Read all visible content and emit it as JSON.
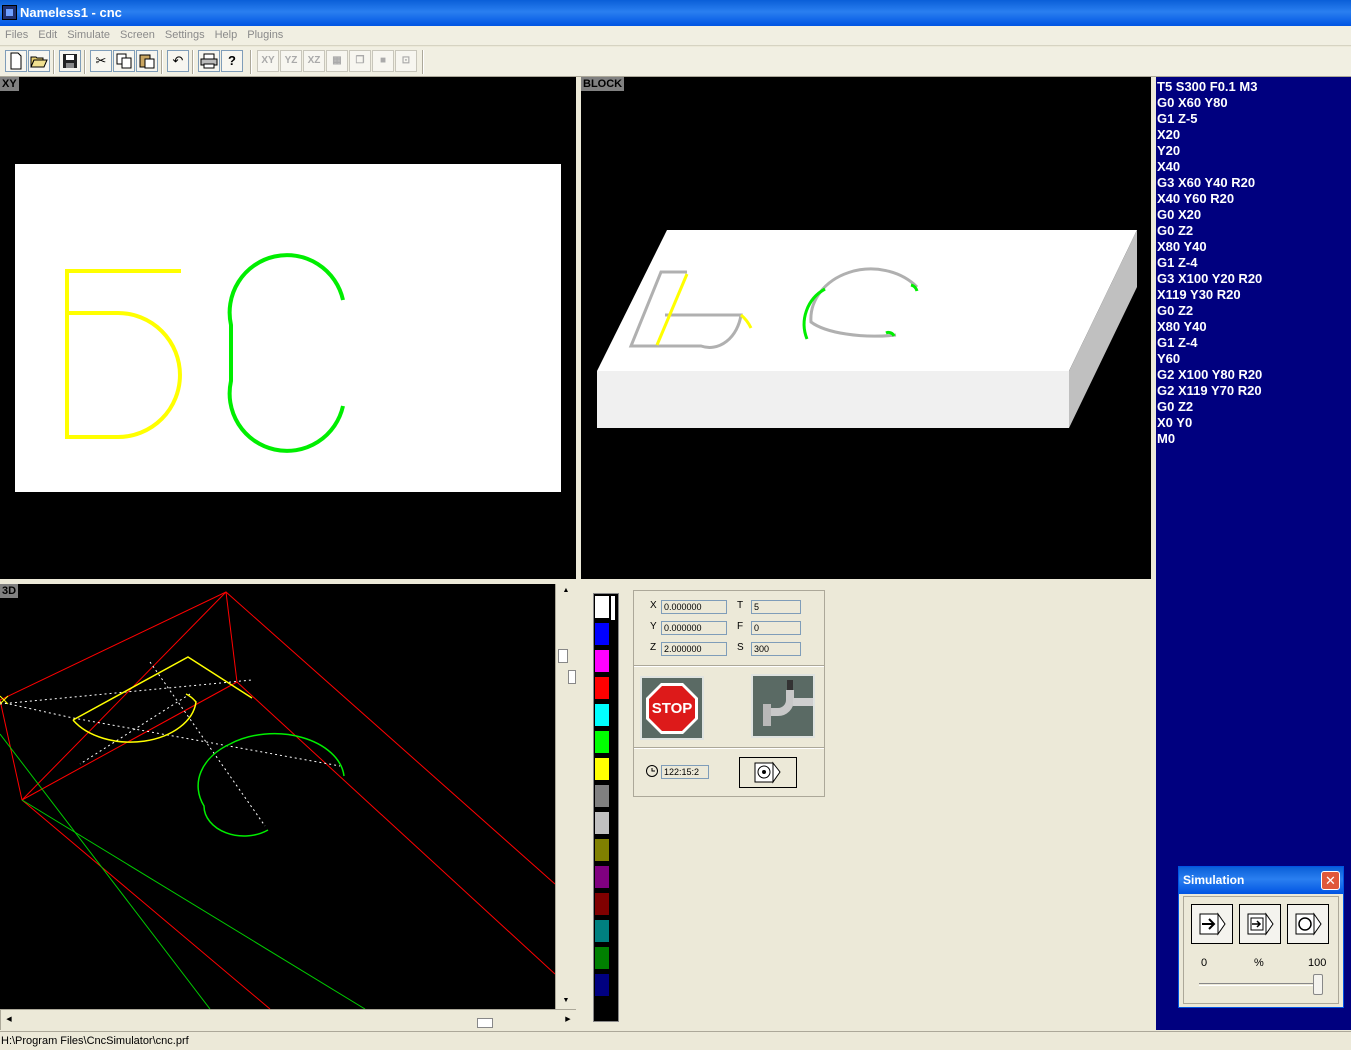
{
  "window": {
    "title": "Nameless1 - cnc"
  },
  "menu": [
    "Files",
    "Edit",
    "Simulate",
    "Screen",
    "Settings",
    "Help",
    "Plugins"
  ],
  "toolbar": {
    "icons": [
      "new-file",
      "open-file",
      "save",
      "cut",
      "copy",
      "paste",
      "undo",
      "print",
      "help"
    ],
    "view_buttons": [
      "XY",
      "YZ",
      "XZ"
    ]
  },
  "views": {
    "xy_label": "XY",
    "block_label": "BLOCK",
    "threed_label": "3D"
  },
  "engraving": {
    "letters": "БС",
    "colors": {
      "b": "#ffff00",
      "s": "#00ee00"
    }
  },
  "gcode": [
    "T5 S300 F0.1 M3",
    "G0 X60 Y80",
    "G1 Z-5",
    "X20",
    "Y20",
    "X40",
    "G3 X60 Y40 R20",
    "X40 Y60 R20",
    "G0 X20",
    "G0 Z2",
    "X80 Y40",
    "G1 Z-4",
    "G3 X100 Y20 R20",
    "X119 Y30 R20",
    "G0 Z2",
    "X80 Y40",
    "G1 Z-4",
    "Y60",
    "G2 X100 Y80 R20",
    "G2 X119 Y70 R20",
    "G0 Z2",
    "X0 Y0",
    "M0"
  ],
  "coords": {
    "x_label": "X",
    "x": "0.000000",
    "y_label": "Y",
    "y": "0.000000",
    "z_label": "Z",
    "z": "2.000000",
    "t_label": "T",
    "t": "5",
    "f_label": "F",
    "f": "0",
    "s_label": "S",
    "s": "300",
    "time": "122:15:2"
  },
  "stop_label": "STOP",
  "palette": [
    "#ffffff",
    "#0000ff",
    "#ff00ff",
    "#ff0000",
    "#00ffff",
    "#00ff00",
    "#ffff00",
    "#808080",
    "#c0c0c0",
    "#808000",
    "#800080",
    "#800000",
    "#008080",
    "#008000",
    "#000080"
  ],
  "simulation": {
    "title": "Simulation",
    "min": "0",
    "unit": "%",
    "max": "100",
    "speed_percent": 100
  },
  "status": {
    "path": "H:\\Program Files\\CncSimulator\\cnc.prf"
  }
}
